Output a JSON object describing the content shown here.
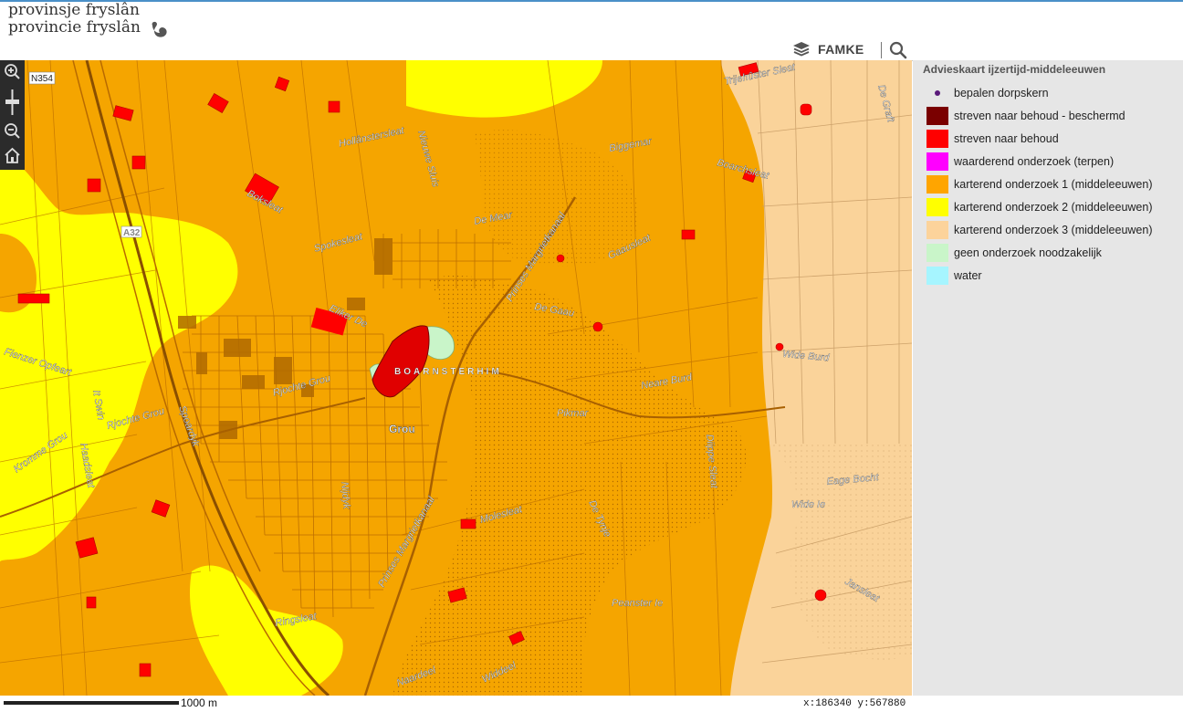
{
  "header": {
    "logo_line1": "provinsje fryslân",
    "logo_line2": "provincie fryslân",
    "layers_label": "FAMKE"
  },
  "map": {
    "road_labels": {
      "n354": "N354",
      "a32": "A32"
    },
    "place_labels": {
      "trijehuster_sleat": "Trijehûster Sleat",
      "de_graft": "De Graft",
      "hollanstersleat": "Hollânstersleat",
      "nieuwe_sluis": "Nieuwe Sluis",
      "biggemar": "Biggemar",
      "boarchsleat": "Boarchsleat",
      "boksleat": "Boksleat",
      "de_mear": "De Mear",
      "prinses_margrietkanaal_n": "Prinses Margrietkanaal",
      "spokesleat": "Spokesleat",
      "gaausleat": "Gaausleat",
      "de_gaau": "De Gaau",
      "eliker_de": "Eliker De",
      "fienzer_opfeart": "Fienzer Opfeart",
      "boarnsterhim": "BOARNSTERHIM",
      "wide_burd": "Wide Burd",
      "rjochte_grou_1": "Rjochte Grou",
      "neare_burd": "Neare Burd",
      "it_swin": "It Swin",
      "pikmar": "Pikmar",
      "rjochte_grou_2": "Rjochte Grou",
      "grou": "Grou",
      "kromme_grou": "Kromme Grou",
      "spoardyk": "Spoardyk",
      "diippe_sleat": "Diippe Sleat",
      "haadsleat": "Haadsleat",
      "eage_bocht": "Eage Bocht",
      "wide_ie": "Wide Ie",
      "nijdyk": "Nijdyk",
      "prinses_margrietkanaal_s": "Prinses Margrietkanaal",
      "molesleat": "Molesleat",
      "de_tynje": "De Tynje",
      "peansterie": "Peanster Ie",
      "jansleat": "Jansleat",
      "ringsleat": "Ringsleat",
      "naardeel": "Naardeel",
      "widdeel": "Widdeel"
    },
    "nav_icons": [
      "zoom-in-icon",
      "zoom-slider",
      "zoom-out-icon",
      "home-icon"
    ]
  },
  "legend": {
    "title": "Advieskaart ijzertijd-middeleeuwen",
    "items": [
      {
        "label": "bepalen dorpskern",
        "color": "#5a1a7a",
        "kind": "dot"
      },
      {
        "label": "streven naar behoud - beschermd",
        "color": "#7a0000",
        "kind": "box"
      },
      {
        "label": "streven naar behoud",
        "color": "#ff0000",
        "kind": "box"
      },
      {
        "label": "waarderend onderzoek (terpen)",
        "color": "#ff00ff",
        "kind": "box"
      },
      {
        "label": "karterend onderzoek 1 (middeleeuwen)",
        "color": "#ffa500",
        "kind": "box"
      },
      {
        "label": "karterend onderzoek 2 (middeleeuwen)",
        "color": "#ffff00",
        "kind": "box"
      },
      {
        "label": "karterend onderzoek 3 (middeleeuwen)",
        "color": "#fcd39b",
        "kind": "box"
      },
      {
        "label": "geen onderzoek noodzakelijk",
        "color": "#c9f5c9",
        "kind": "box"
      },
      {
        "label": "water",
        "color": "#a6f5ff",
        "kind": "box"
      }
    ]
  },
  "footer": {
    "scale_label": "1000 m",
    "coordinates": "x:186340  y:567880"
  }
}
